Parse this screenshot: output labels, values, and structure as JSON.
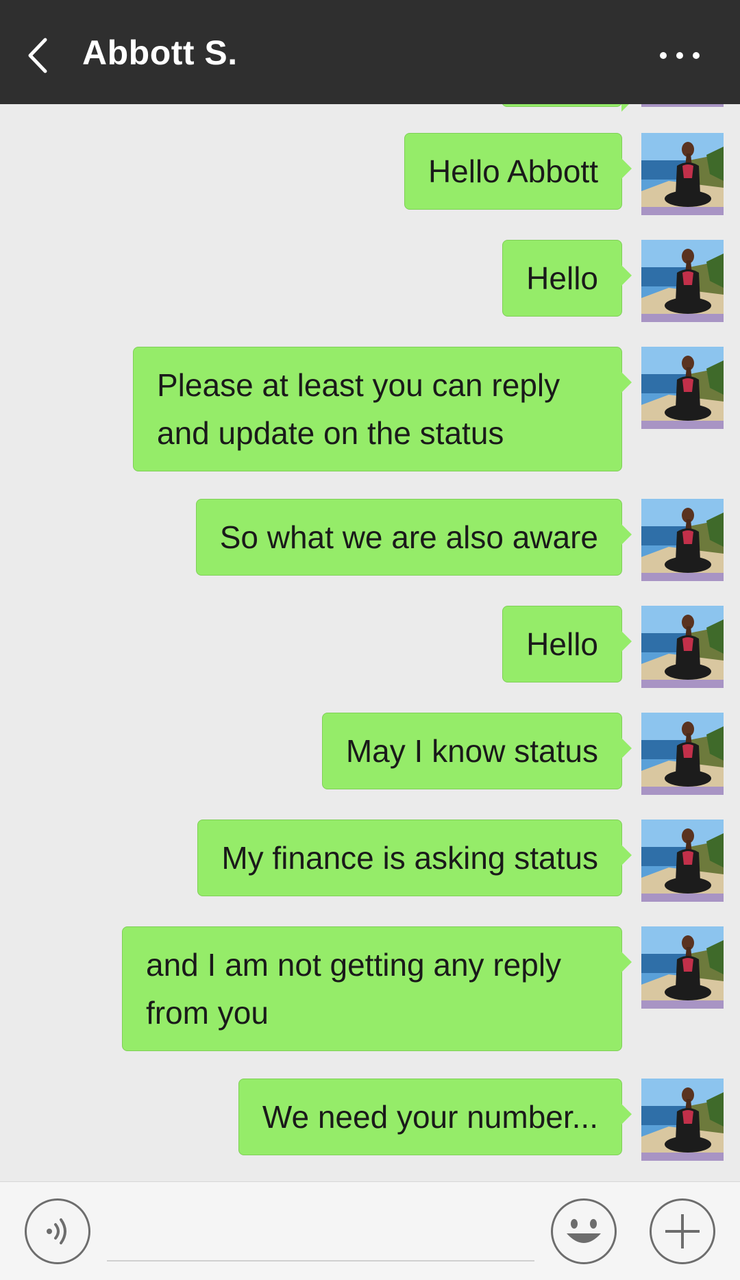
{
  "header": {
    "title": "Abbott S.",
    "back_icon": "chevron-left-icon",
    "more_icon": "more-horizontal-icon",
    "background": "#2f2f2f"
  },
  "messages": [
    {
      "sender": "me",
      "text": "Hello Abbott"
    },
    {
      "sender": "me",
      "text": "Hello"
    },
    {
      "sender": "me",
      "text": "Please at least you can reply and update on the status"
    },
    {
      "sender": "me",
      "text": "So what we are also aware"
    },
    {
      "sender": "me",
      "text": "Hello"
    },
    {
      "sender": "me",
      "text": "May I know status"
    },
    {
      "sender": "me",
      "text": "My finance is asking status"
    },
    {
      "sender": "me",
      "text": "and I am not getting any reply from you"
    },
    {
      "sender": "me",
      "text": "We need your number..."
    }
  ],
  "input_bar": {
    "voice_icon": "voice-input-icon",
    "emoji_icon": "emoji-icon",
    "plus_icon": "plus-icon",
    "text_value": ""
  },
  "colors": {
    "bubble": "#95ec69",
    "chat_background": "#ebebeb"
  }
}
